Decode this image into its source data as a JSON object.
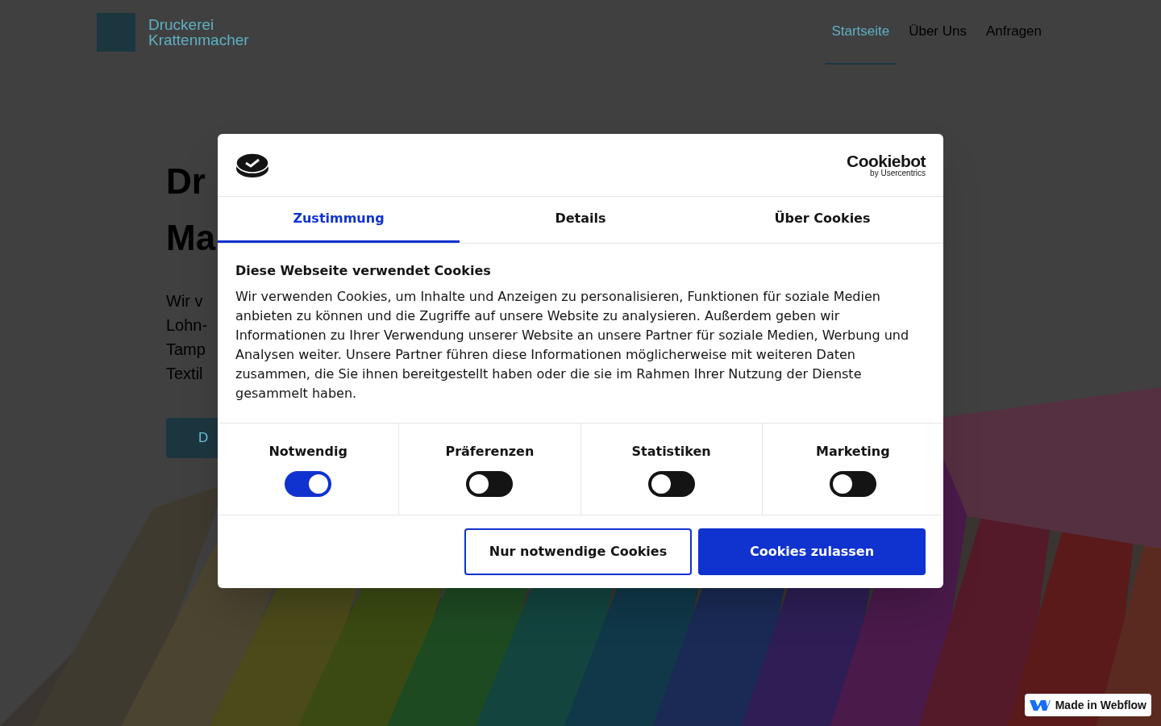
{
  "header": {
    "logo_lines": [
      "Druckerei",
      "Krattenmacher"
    ],
    "nav": [
      {
        "label": "Startseite",
        "selected": true
      },
      {
        "label": "Über Uns",
        "selected": false
      },
      {
        "label": "Anfragen",
        "selected": false
      }
    ]
  },
  "hero": {
    "heading_lines": [
      "Dr",
      "Ma"
    ],
    "text_lines": [
      "Wir v",
      "Lohn-",
      "Tamp",
      "Textil"
    ],
    "button": "D"
  },
  "cookie_dialog": {
    "brand": "Cookiebot",
    "brand_sub": "by Usercentrics",
    "tabs": [
      {
        "label": "Zustimmung",
        "selected": true
      },
      {
        "label": "Details",
        "selected": false
      },
      {
        "label": "Über Cookies",
        "selected": false
      }
    ],
    "title": "Diese Webseite verwendet Cookies",
    "text": "Wir verwenden Cookies, um Inhalte und Anzeigen zu personalisieren, Funktionen für soziale Medien anbieten zu können und die Zugriffe auf unsere Website zu analysieren. Außerdem geben wir Informationen zu Ihrer Verwendung unserer Website an unsere Partner für soziale Medien, Werbung und Analysen weiter. Unsere Partner führen diese Informationen möglicherweise mit weiteren Daten zusammen, die Sie ihnen bereitgestellt haben oder die sie im Rahmen Ihrer Nutzung der Dienste gesammelt haben.",
    "categories": [
      {
        "label": "Notwendig",
        "on": true
      },
      {
        "label": "Präferenzen",
        "on": false
      },
      {
        "label": "Statistiken",
        "on": false
      },
      {
        "label": "Marketing",
        "on": false
      }
    ],
    "buttons": [
      {
        "label": "Nur notwendige Cookies",
        "kind": "outline"
      },
      {
        "label": "Cookies zulassen",
        "kind": "primary"
      }
    ]
  },
  "badge": {
    "label": "Made in Webflow"
  }
}
